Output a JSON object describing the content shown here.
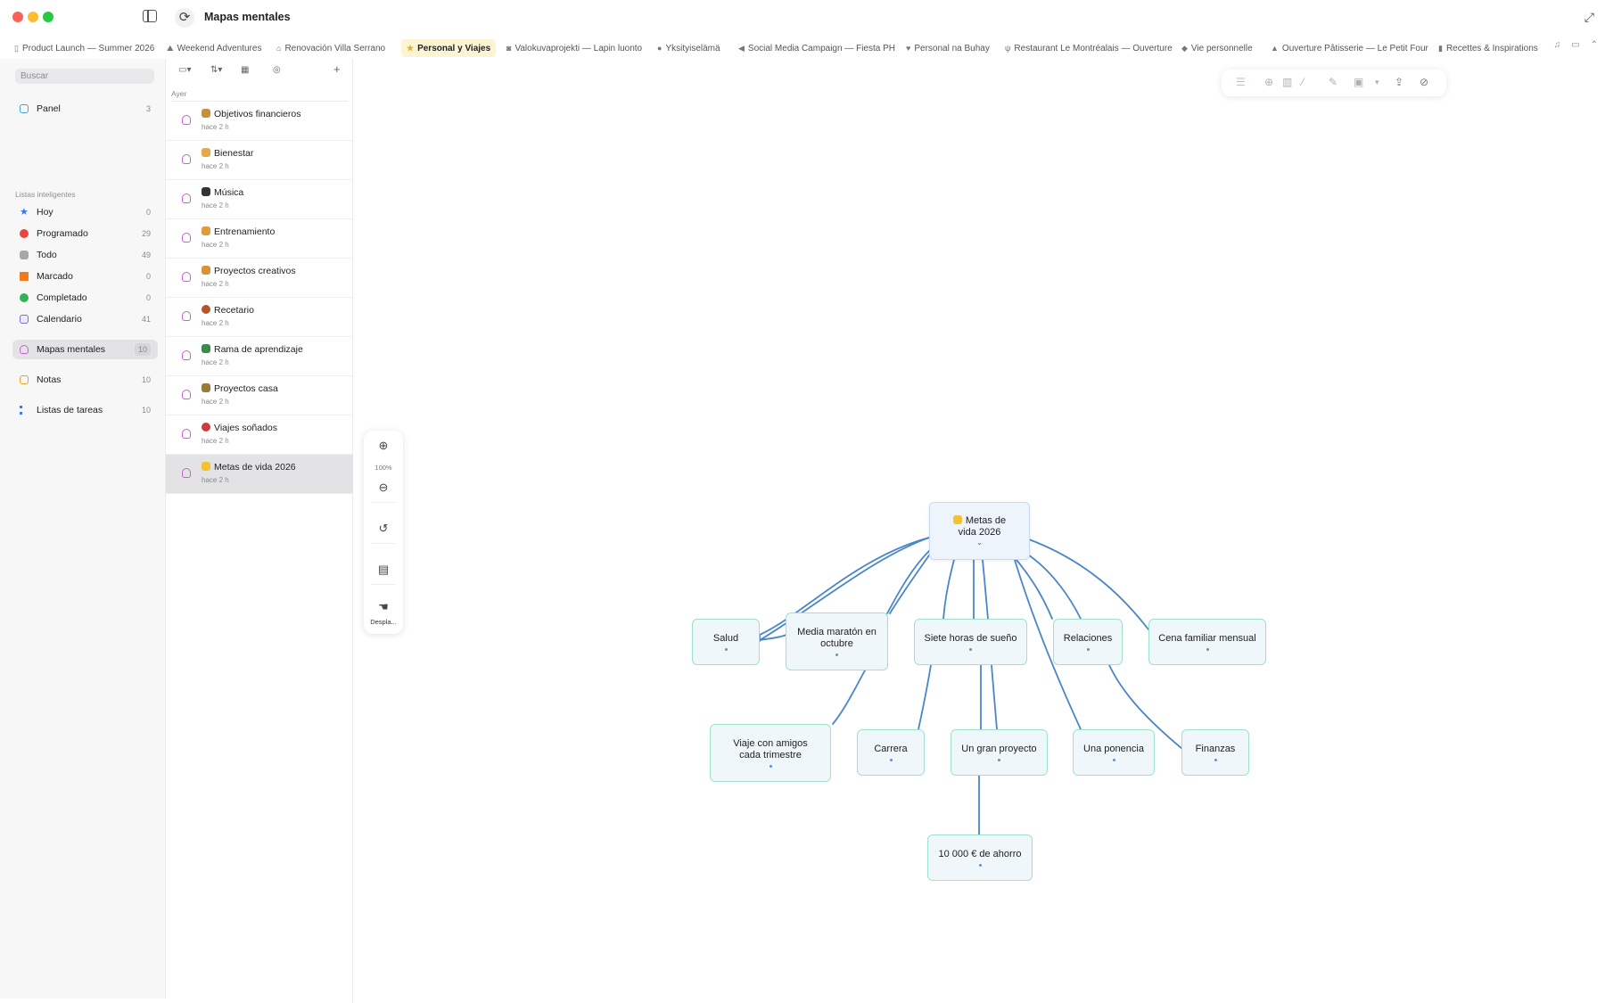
{
  "app": {
    "title": "Mapas mentales"
  },
  "tabs": [
    {
      "label": "Product Launch — Summer 2026",
      "icon": "document-icon"
    },
    {
      "label": "Weekend Adventures",
      "icon": "hiker-icon"
    },
    {
      "label": "Renovación Villa Serrano",
      "icon": "house-icon"
    },
    {
      "label": "Personal y Viajes",
      "icon": "star-icon",
      "active": true
    },
    {
      "label": "Valokuvaprojekti — Lapin luonto",
      "icon": "camera-icon"
    },
    {
      "label": "Yksityiselämä",
      "icon": "circle-icon"
    },
    {
      "label": "Social Media Campaign — Fiesta PH",
      "icon": "megaphone-icon"
    },
    {
      "label": "Personal na Buhay",
      "icon": "heart-icon"
    },
    {
      "label": "Restaurant Le Montréalais — Ouverture",
      "icon": "fork-knife-icon"
    },
    {
      "label": "Vie personnelle",
      "icon": "tag-icon"
    },
    {
      "label": "Ouverture Pâtisserie — Le Petit Four",
      "icon": "cake-icon"
    },
    {
      "label": "Recettes & Inspirations",
      "icon": "book-icon"
    }
  ],
  "sidebar": {
    "search_placeholder": "Buscar",
    "panel": {
      "label": "Panel",
      "count": "3",
      "icon": "panel-icon",
      "color": "#3aa9d8"
    },
    "smart_lists_header": "Listas inteligentes",
    "smart": [
      {
        "label": "Hoy",
        "count": "0",
        "icon": "star-icon",
        "color": "#2f7be8"
      },
      {
        "label": "Programado",
        "count": "29",
        "icon": "calendar-clock-icon",
        "color": "#e8453c"
      },
      {
        "label": "Todo",
        "count": "49",
        "icon": "tray-icon",
        "color": "#8e8e93"
      },
      {
        "label": "Marcado",
        "count": "0",
        "icon": "flag-icon",
        "color": "#f07b1a"
      },
      {
        "label": "Completado",
        "count": "0",
        "icon": "check-circle-icon",
        "color": "#2fb551"
      },
      {
        "label": "Calendario",
        "count": "41",
        "icon": "calendar-icon",
        "color": "#7a6ee0"
      }
    ],
    "sections": [
      {
        "label": "Mapas mentales",
        "count": "10",
        "icon": "head-icon",
        "color": "#c65fd2",
        "selected": true
      },
      {
        "label": "Notas",
        "count": "10",
        "icon": "note-icon",
        "color": "#f0a020"
      },
      {
        "label": "Listas de tareas",
        "count": "10",
        "icon": "checklist-icon",
        "color": "#3a7be0"
      }
    ]
  },
  "list": {
    "group": "Ayer",
    "items": [
      {
        "title": "Objetivos financieros",
        "sub": "hace 2 h",
        "emoji_color": "#c7913b"
      },
      {
        "title": "Bienestar",
        "sub": "hace 2 h",
        "emoji_color": "#e3a94a"
      },
      {
        "title": "Música",
        "sub": "hace 2 h",
        "emoji_color": "#333333"
      },
      {
        "title": "Entrenamiento",
        "sub": "hace 2 h",
        "emoji_color": "#e09a3a"
      },
      {
        "title": "Proyectos creativos",
        "sub": "hace 2 h",
        "emoji_color": "#d8933a"
      },
      {
        "title": "Recetario",
        "sub": "hace 2 h",
        "emoji_color": "#b4562a"
      },
      {
        "title": "Rama de aprendizaje",
        "sub": "hace 2 h",
        "emoji_color": "#3c8a4a"
      },
      {
        "title": "Proyectos casa",
        "sub": "hace 2 h",
        "emoji_color": "#9a7a3a"
      },
      {
        "title": "Viajes soñados",
        "sub": "hace 2 h",
        "emoji_color": "#d03a3a"
      },
      {
        "title": "Metas de vida 2026",
        "sub": "hace 2 h",
        "emoji_color": "#f2c230",
        "selected": true
      }
    ]
  },
  "zoom": {
    "level": "100%",
    "pan_label": "Despla..."
  },
  "mindmap": {
    "root": {
      "line1": "Metas de",
      "line2": "vida 2026",
      "emoji_color": "#f2c230"
    },
    "nodes": [
      {
        "label": "Salud"
      },
      {
        "label": "Media maratón en octubre"
      },
      {
        "label": "Siete horas de sueño"
      },
      {
        "label": "Relaciones"
      },
      {
        "label": "Cena familiar mensual"
      },
      {
        "label": "Viaje con amigos cada trimestre"
      },
      {
        "label": "Carrera"
      },
      {
        "label": "Un gran proyecto"
      },
      {
        "label": "Una ponencia"
      },
      {
        "label": "Finanzas"
      },
      {
        "label": "10 000 € de ahorro"
      }
    ],
    "link_color": "#4a86c8"
  }
}
